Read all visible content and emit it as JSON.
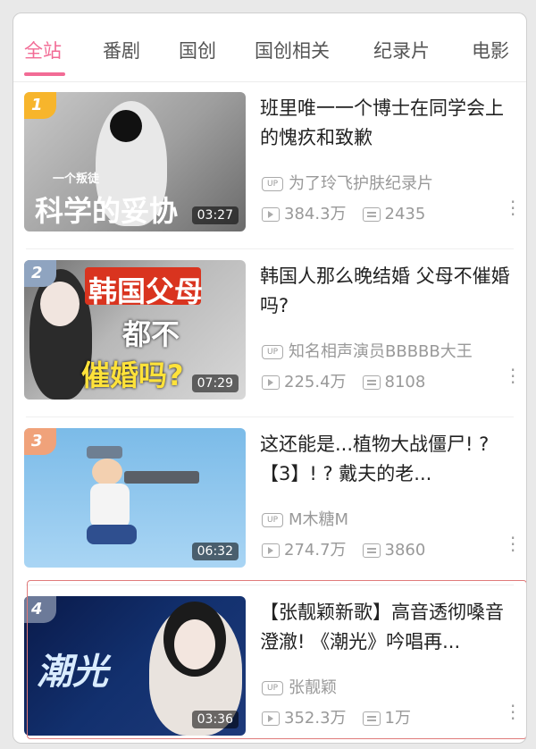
{
  "tabs": [
    "全站",
    "番剧",
    "国创",
    "国创相关",
    "纪录片",
    "电影"
  ],
  "active_tab": 0,
  "videos": [
    {
      "rank": "1",
      "thumb_text_small": "一个叛徒",
      "thumb_text": "科学的妥协",
      "duration": "03:27",
      "title": "班里唯一一个博士在同学会上的愧疚和致歉",
      "uploader": "为了玲飞护肤纪录片",
      "views": "384.3万",
      "danmaku": "2435"
    },
    {
      "rank": "2",
      "thumb_text": "韩国父母",
      "thumb_text2": "都不",
      "thumb_text3": "催婚吗?",
      "duration": "07:29",
      "title": "韩国人那么晚结婚 父母不催婚吗?",
      "uploader": "知名相声演员BBBBB大王",
      "views": "225.4万",
      "danmaku": "8108"
    },
    {
      "rank": "3",
      "duration": "06:32",
      "title": "这还能是...植物大战僵尸! ? 【3】! ? 戴夫的老...",
      "uploader": "M木糖M",
      "views": "274.7万",
      "danmaku": "3860"
    },
    {
      "rank": "4",
      "thumb_text": "潮光",
      "duration": "03:36",
      "title": "【张靓颖新歌】高音透彻嗓音澄澈! 《潮光》吟唱再...",
      "uploader": "张靓颖",
      "views": "352.3万",
      "danmaku": "1万"
    }
  ],
  "labels": {
    "up_badge": "UP"
  },
  "colors": {
    "accent": "#f26b95",
    "highlight_border": "#e07a7a"
  }
}
